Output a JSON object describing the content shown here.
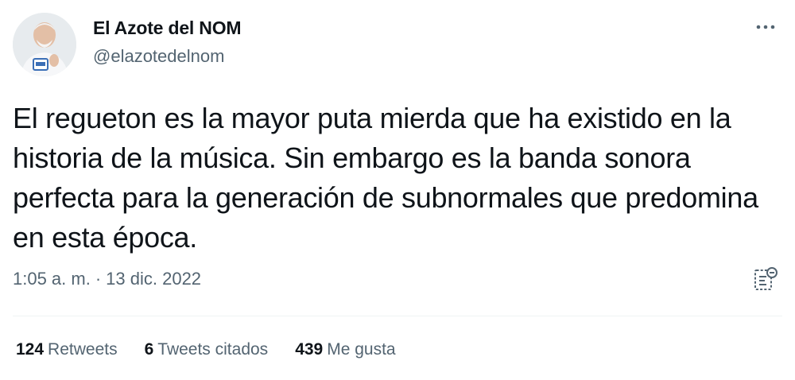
{
  "user": {
    "display_name": "El Azote del NOM",
    "handle": "@elazotedelnom"
  },
  "tweet": {
    "text": "El regueton es la mayor puta mierda que ha existido en la historia de la música. Sin embargo es la banda sonora perfecta para la generación de subnormales que predomina en esta época.",
    "time": "1:05 a. m.",
    "separator": "·",
    "date": "13 dic. 2022"
  },
  "stats": {
    "retweets_count": "124",
    "retweets_label": "Retweets",
    "quotes_count": "6",
    "quotes_label": "Tweets citados",
    "likes_count": "439",
    "likes_label": "Me gusta"
  },
  "icons": {
    "more": "more-options-icon",
    "analytics": "tweet-analytics-icon",
    "avatar": "avatar-photo"
  },
  "colors": {
    "text_primary": "#0f1419",
    "text_secondary": "#536471",
    "divider": "#eff3f4"
  }
}
